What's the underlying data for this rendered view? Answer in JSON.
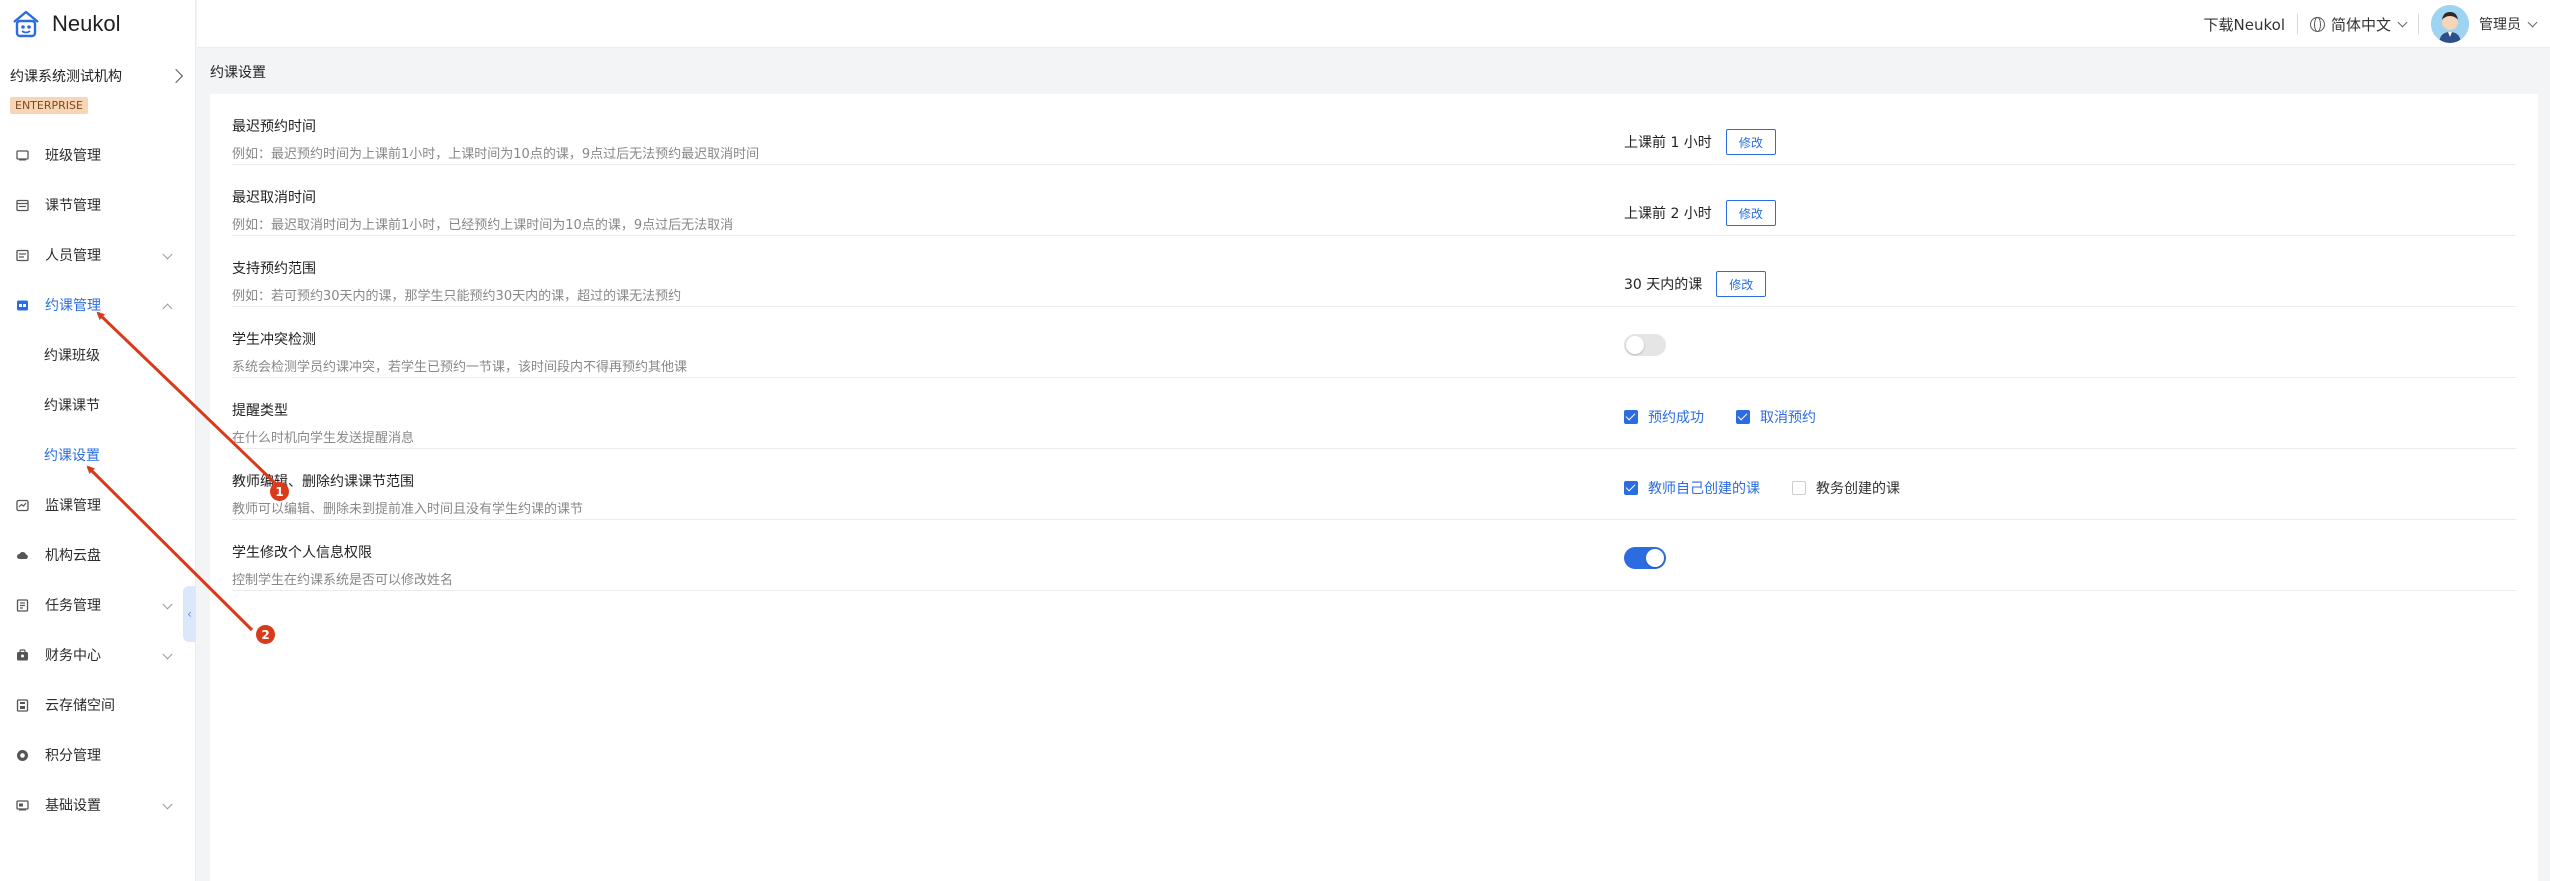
{
  "brand": {
    "name": "Neukol",
    "icon": "home-icon"
  },
  "org": {
    "name": "约课系统测试机构",
    "badge": "ENTERPRISE"
  },
  "sidebar": {
    "items": [
      {
        "label": "班级管理",
        "icon": "class-icon"
      },
      {
        "label": "课节管理",
        "icon": "lesson-icon"
      },
      {
        "label": "人员管理",
        "icon": "people-icon",
        "expandable": true
      },
      {
        "label": "约课管理",
        "icon": "booking-icon",
        "expanded": true,
        "active": true,
        "children": [
          {
            "label": "约课班级"
          },
          {
            "label": "约课课节"
          },
          {
            "label": "约课设置",
            "active": true
          }
        ]
      },
      {
        "label": "监课管理",
        "icon": "monitor-icon"
      },
      {
        "label": "机构云盘",
        "icon": "cloud-icon"
      },
      {
        "label": "任务管理",
        "icon": "task-icon",
        "expandable": true
      },
      {
        "label": "财务中心",
        "icon": "finance-icon",
        "expandable": true
      },
      {
        "label": "云存储空间",
        "icon": "storage-icon"
      },
      {
        "label": "积分管理",
        "icon": "points-icon"
      },
      {
        "label": "基础设置",
        "icon": "settings-icon",
        "expandable": true
      }
    ]
  },
  "topbar": {
    "download": "下载Neukol",
    "language": "简体中文",
    "user": "管理员"
  },
  "page": {
    "title": "约课设置"
  },
  "settings": [
    {
      "title": "最迟预约时间",
      "desc": "例如：最迟预约时间为上课前1小时，上课时间为10点的课，9点过后无法预约最迟取消时间",
      "value": "上课前 1 小时",
      "button": "修改"
    },
    {
      "title": "最迟取消时间",
      "desc": "例如：最迟取消时间为上课前1小时，已经预约上课时间为10点的课，9点过后无法取消",
      "value": "上课前 2 小时",
      "button": "修改"
    },
    {
      "title": "支持预约范围",
      "desc": "例如：若可预约30天内的课，那学生只能预约30天内的课，超过的课无法预约",
      "value": "30 天内的课",
      "button": "修改"
    },
    {
      "title": "学生冲突检测",
      "desc": "系统会检测学员约课冲突，若学生已预约一节课，该时间段内不得再预约其他课",
      "switch_on": false
    },
    {
      "title": "提醒类型",
      "desc": "在什么时机向学生发送提醒消息",
      "options": [
        {
          "label": "预约成功",
          "checked": true
        },
        {
          "label": "取消预约",
          "checked": true
        }
      ]
    },
    {
      "title": "教师编辑、删除约课课节范围",
      "desc": "教师可以编辑、删除未到提前准入时间且没有学生约课的课节",
      "options": [
        {
          "label": "教师自己创建的课",
          "checked": true
        },
        {
          "label": "教务创建的课",
          "checked": false
        }
      ]
    },
    {
      "title": "学生修改个人信息权限",
      "desc": "控制学生在约课系统是否可以修改姓名",
      "switch_on": true
    }
  ],
  "annotations": [
    {
      "label": "1"
    },
    {
      "label": "2"
    }
  ],
  "colors": {
    "accent": "#2b6de0",
    "annotation": "#d93a1a"
  }
}
